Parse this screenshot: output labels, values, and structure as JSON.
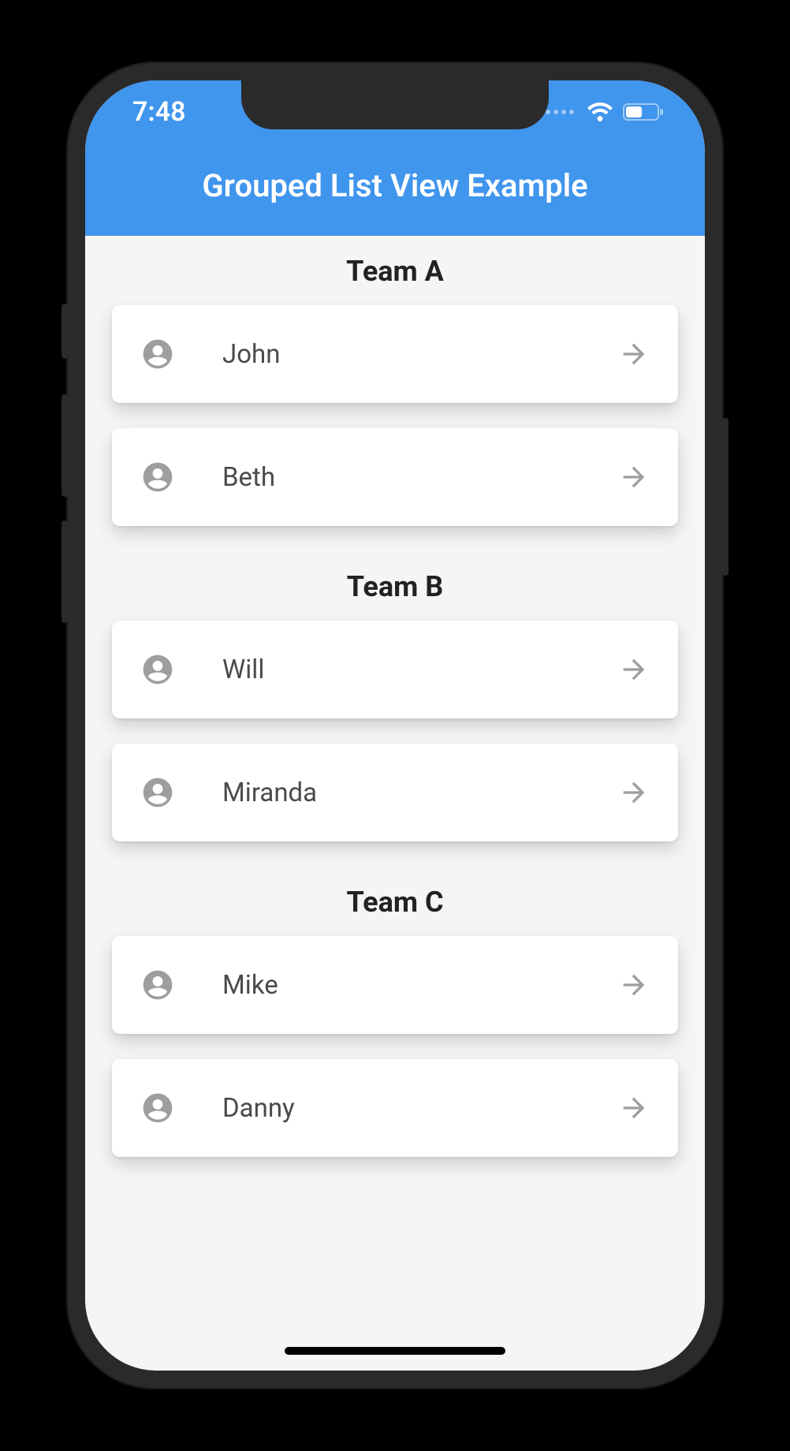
{
  "status": {
    "time": "7:48"
  },
  "header": {
    "title": "Grouped List View Example"
  },
  "groups": [
    {
      "title": "Team A",
      "items": [
        {
          "name": "John"
        },
        {
          "name": "Beth"
        }
      ]
    },
    {
      "title": "Team B",
      "items": [
        {
          "name": "Will"
        },
        {
          "name": "Miranda"
        }
      ]
    },
    {
      "title": "Team C",
      "items": [
        {
          "name": "Mike"
        },
        {
          "name": "Danny"
        }
      ]
    }
  ]
}
